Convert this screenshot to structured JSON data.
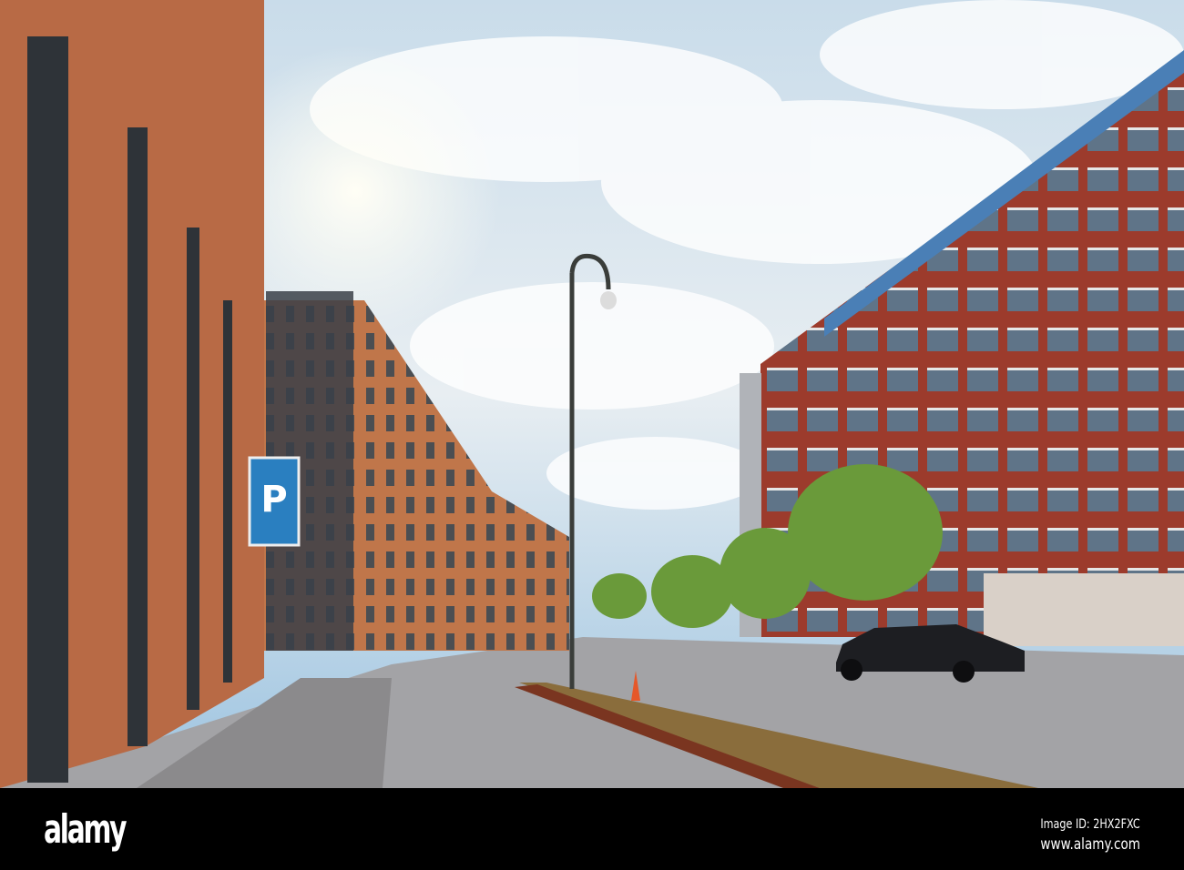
{
  "photo": {
    "parking_sign": "P",
    "colors": {
      "sky": "#9cc3e0",
      "brick": "#b86a45",
      "red_brick": "#9c3b2c",
      "road": "#9a9a9c",
      "tree": "#6a9a3a"
    }
  },
  "footer": {
    "logo": "alamy",
    "image_id": "Image ID: 2HX2FXC",
    "url": "www.alamy.com"
  }
}
